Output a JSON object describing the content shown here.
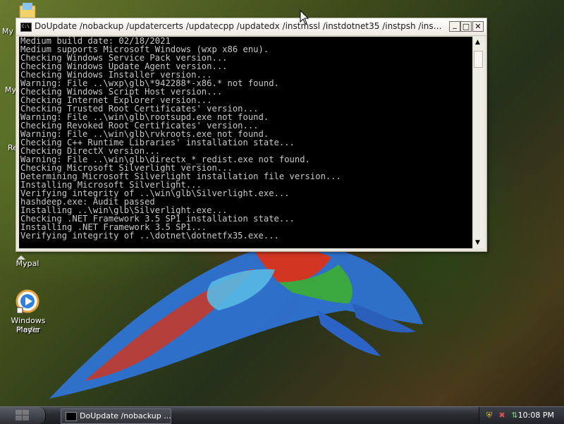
{
  "desktop": {
    "labels": {
      "my1": "My",
      "my2": "My",
      "re": "Re",
      "mypal": "Mypal",
      "wmp_line1": "Windows Media",
      "wmp_line2": "Player"
    }
  },
  "window": {
    "title": "DoUpdate /nobackup /updatercerts /updatecpp /updatedx /instmssl /instdotnet35 /instpsh /instdot...",
    "minimize_glyph": "_",
    "maximize_glyph": "□",
    "close_glyph": "✕",
    "console_lines": [
      "Medium build date: 02/18/2021",
      "Medium supports Microsoft Windows (wxp x86 enu).",
      "Checking Windows Service Pack version...",
      "Checking Windows Update Agent version...",
      "Checking Windows Installer version...",
      "Warning: File ..\\wxp\\glb\\*942288*-x86.* not found.",
      "Checking Windows Script Host version...",
      "Checking Internet Explorer version...",
      "Checking Trusted Root Certificates' version...",
      "Warning: File ..\\win\\glb\\rootsupd.exe not found.",
      "Checking Revoked Root Certificates' version...",
      "Warning: File ..\\win\\glb\\rvkroots.exe not found.",
      "Checking C++ Runtime Libraries' installation state...",
      "Checking DirectX version...",
      "Warning: File ..\\win\\glb\\directx_*_redist.exe not found.",
      "Checking Microsoft Silverlight version...",
      "Determining Microsoft Silverlight installation file version...",
      "Installing Microsoft Silverlight...",
      "Verifying integrity of ..\\win\\glb\\Silverlight.exe...",
      "hashdeep.exe: Audit passed",
      "Installing ..\\win\\glb\\Silverlight.exe...",
      "Checking .NET Framework 3.5 SP1 installation state...",
      "Installing .NET Framework 3.5 SP1...",
      "Verifying integrity of ..\\dotnet\\dotnetfx35.exe..."
    ]
  },
  "taskbar": {
    "task_label": "DoUpdate /nobackup ...",
    "clock": "10:08 PM"
  },
  "icons": {
    "console": "console-icon",
    "shield": "security-shield-icon",
    "alert": "security-alert-icon",
    "network": "network-icon"
  },
  "colors": {
    "console_bg": "#000000",
    "console_text": "#c8c8c8",
    "taskbar": "#2b2d32"
  }
}
